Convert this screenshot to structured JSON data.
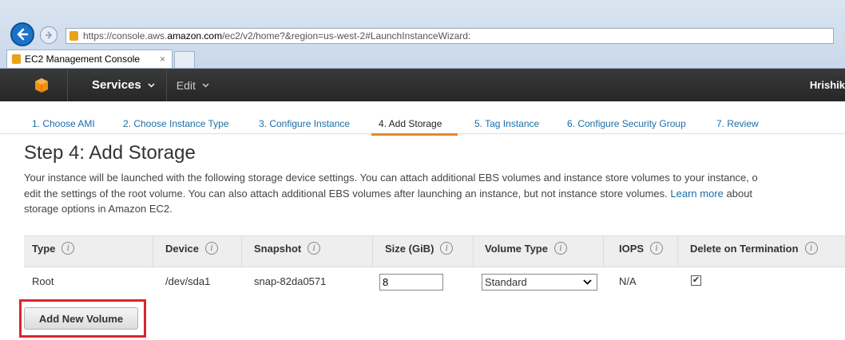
{
  "browser": {
    "url_prefix": "https://console.aws.",
    "url_domain": "amazon.com",
    "url_rest": "/ec2/v2/home?&region=us-west-2#LaunchInstanceWizard:",
    "tab_title": "EC2 Management Console",
    "tab_close": "×"
  },
  "header": {
    "services_label": "Services",
    "edit_label": "Edit",
    "user_label": "Hrishik"
  },
  "wizard_steps": [
    "1. Choose AMI",
    "2. Choose Instance Type",
    "3. Configure Instance",
    "4. Add Storage",
    "5. Tag Instance",
    "6. Configure Security Group",
    "7. Review"
  ],
  "page": {
    "title": "Step 4: Add Storage",
    "desc_line1": "Your instance will be launched with the following storage device settings. You can attach additional EBS volumes and instance store volumes to your instance, o",
    "desc_line2": "edit the settings of the root volume. You can also attach additional EBS volumes after launching an instance, but not instance store volumes.",
    "desc_link": "Learn more",
    "desc_line2_end": "about",
    "desc_line3": "storage options in Amazon EC2."
  },
  "table": {
    "info_glyph": "i",
    "headers": [
      "Type",
      "Device",
      "Snapshot",
      "Size (GiB)",
      "Volume Type",
      "IOPS",
      "Delete on Termination"
    ],
    "row": {
      "type": "Root",
      "device": "/dev/sda1",
      "snapshot": "snap-82da0571",
      "size": "8",
      "volume_type": "Standard",
      "iops": "N/A",
      "delete_on_termination_mark": "✔"
    }
  },
  "actions": {
    "add_volume_label": "Add New Volume"
  },
  "colors": {
    "aws_header": "#2b2b2b",
    "link": "#1a6ea8",
    "active_step_underline": "#e7872a",
    "highlight_box": "#d9262e"
  }
}
